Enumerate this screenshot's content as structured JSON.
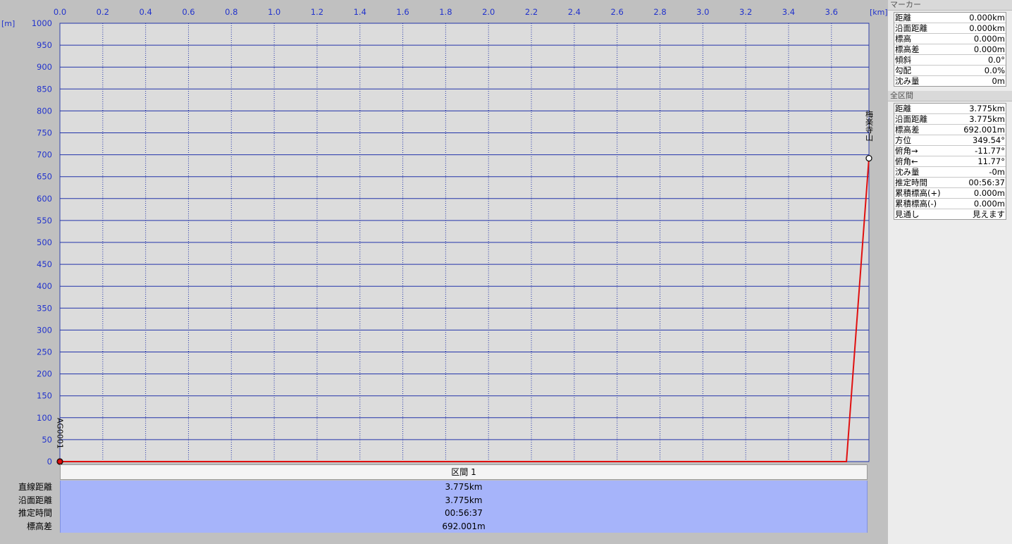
{
  "chart_data": {
    "type": "line",
    "title": "",
    "x_unit": "[km]",
    "y_unit": "[m]",
    "xlim": [
      0,
      3.775
    ],
    "ylim": [
      0,
      1000
    ],
    "x_ticks": [
      "0.0",
      "0.2",
      "0.4",
      "0.6",
      "0.8",
      "1.0",
      "1.2",
      "1.4",
      "1.6",
      "1.8",
      "2.0",
      "2.2",
      "2.4",
      "2.6",
      "2.8",
      "3.0",
      "3.2",
      "3.4",
      "3.6"
    ],
    "y_ticks": [
      "1000",
      "950",
      "900",
      "850",
      "800",
      "750",
      "700",
      "650",
      "600",
      "550",
      "500",
      "450",
      "400",
      "350",
      "300",
      "250",
      "200",
      "150",
      "100",
      "50",
      "0"
    ],
    "grid": true,
    "series": [
      {
        "color": "#e01010",
        "points": [
          [
            0,
            0
          ],
          [
            3.67,
            0
          ],
          [
            3.775,
            692.001
          ]
        ]
      }
    ],
    "waypoints": [
      {
        "label": "AG0001",
        "x": 0,
        "y": 0
      },
      {
        "label": "梅楽寺山",
        "x": 3.775,
        "y": 692.001
      }
    ],
    "colors": {
      "plot_bg": "#dcdcdc",
      "grid": "#2233aa",
      "axis_text": "#2233cc",
      "line": "#e01010"
    }
  },
  "section_table": {
    "header": "区間 1",
    "row_labels": [
      "直線距離",
      "沿面距離",
      "推定時間",
      "標高差"
    ],
    "row_values": [
      "3.775km",
      "3.775km",
      "00:56:37",
      "692.001m"
    ]
  },
  "marker_panel": {
    "title": "マーカー",
    "rows": [
      {
        "label": "距離",
        "value": "0.000km"
      },
      {
        "label": "沿面距離",
        "value": "0.000km"
      },
      {
        "label": "標高",
        "value": "0.000m"
      },
      {
        "label": "標高差",
        "value": "0.000m"
      },
      {
        "label": "傾斜",
        "value": "0.0°"
      },
      {
        "label": "勾配",
        "value": "0.0%"
      },
      {
        "label": "沈み量",
        "value": "0m"
      }
    ]
  },
  "total_panel": {
    "title": "全区間",
    "rows": [
      {
        "label": "距離",
        "value": "3.775km"
      },
      {
        "label": "沿面距離",
        "value": "3.775km"
      },
      {
        "label": "標高差",
        "value": "692.001m"
      },
      {
        "label": "方位",
        "value": "349.54°"
      },
      {
        "label": "俯角→",
        "value": "-11.77°"
      },
      {
        "label": "俯角←",
        "value": "11.77°"
      },
      {
        "label": "沈み量",
        "value": "-0m"
      },
      {
        "label": "推定時間",
        "value": "00:56:37"
      },
      {
        "label": "累積標高(+)",
        "value": "0.000m"
      },
      {
        "label": "累積標高(-)",
        "value": "0.000m"
      },
      {
        "label": "見通し",
        "value": "見えます"
      }
    ]
  }
}
